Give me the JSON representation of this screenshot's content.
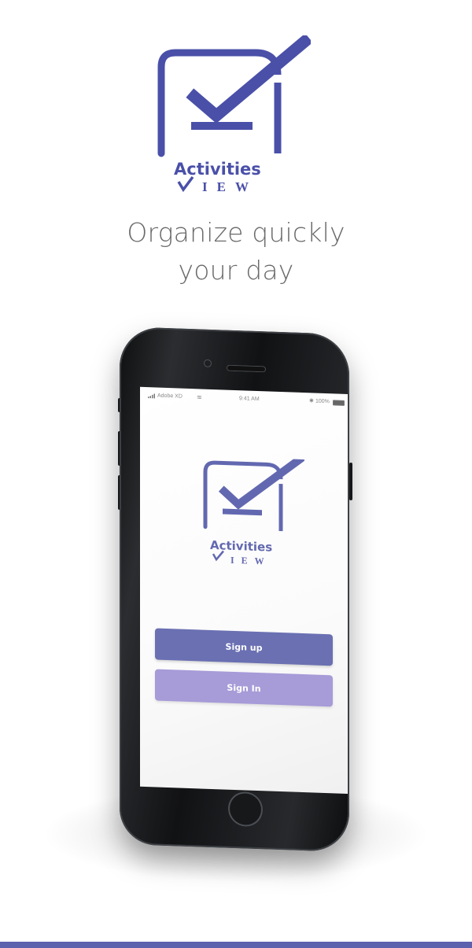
{
  "brand": {
    "logo_word": "Activities",
    "logo_sub": "IEW",
    "logo_alt": "logo-icon",
    "color": "#4a50a8",
    "screen_color": "#6268b0"
  },
  "tagline": {
    "line1": "Organize quickly",
    "line2": "your day"
  },
  "phone": {
    "status": {
      "carrier": "Adobe XD",
      "time": "9:41 AM",
      "battery": "100%",
      "bluetooth": "✱",
      "wifi": "≋"
    },
    "buttons": {
      "signup_label": "Sign up",
      "signin_label": "Sign In"
    }
  },
  "accent": "#5c62ad"
}
